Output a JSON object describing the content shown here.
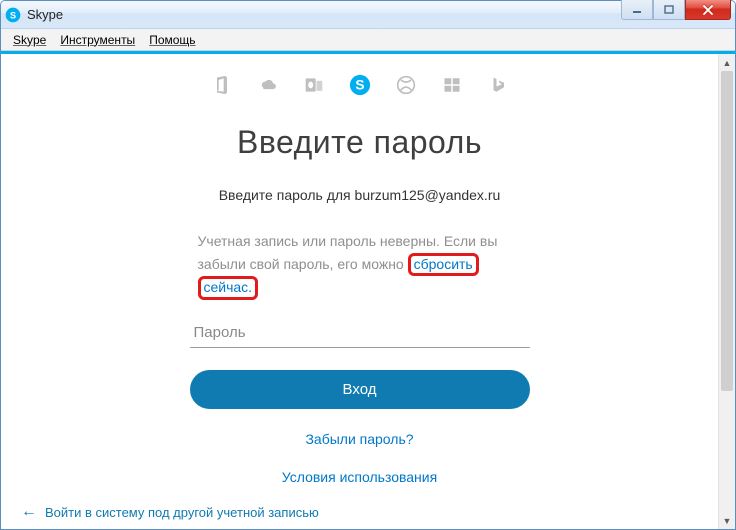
{
  "window": {
    "title": "Skype"
  },
  "menubar": {
    "items": [
      "Skype",
      "Инструменты",
      "Помощь"
    ]
  },
  "service_icons": [
    "office",
    "onedrive",
    "outlook",
    "skype",
    "xbox",
    "windows",
    "bing"
  ],
  "active_service_index": 3,
  "form": {
    "heading": "Введите пароль",
    "subhead_prefix": "Введите пароль для ",
    "account": "burzum125@yandex.ru",
    "error_part1": "Учетная запись или пароль неверны. Если вы забыли свой пароль, его можно ",
    "reset_link_word1": "сбросить",
    "reset_link_word2": "сейчас.",
    "password_placeholder": "Пароль",
    "signin_label": "Вход",
    "forgot_label": "Забыли пароль?",
    "terms_label": "Условия использования"
  },
  "footer": {
    "other_account": "Войти в систему под другой учетной записью"
  }
}
